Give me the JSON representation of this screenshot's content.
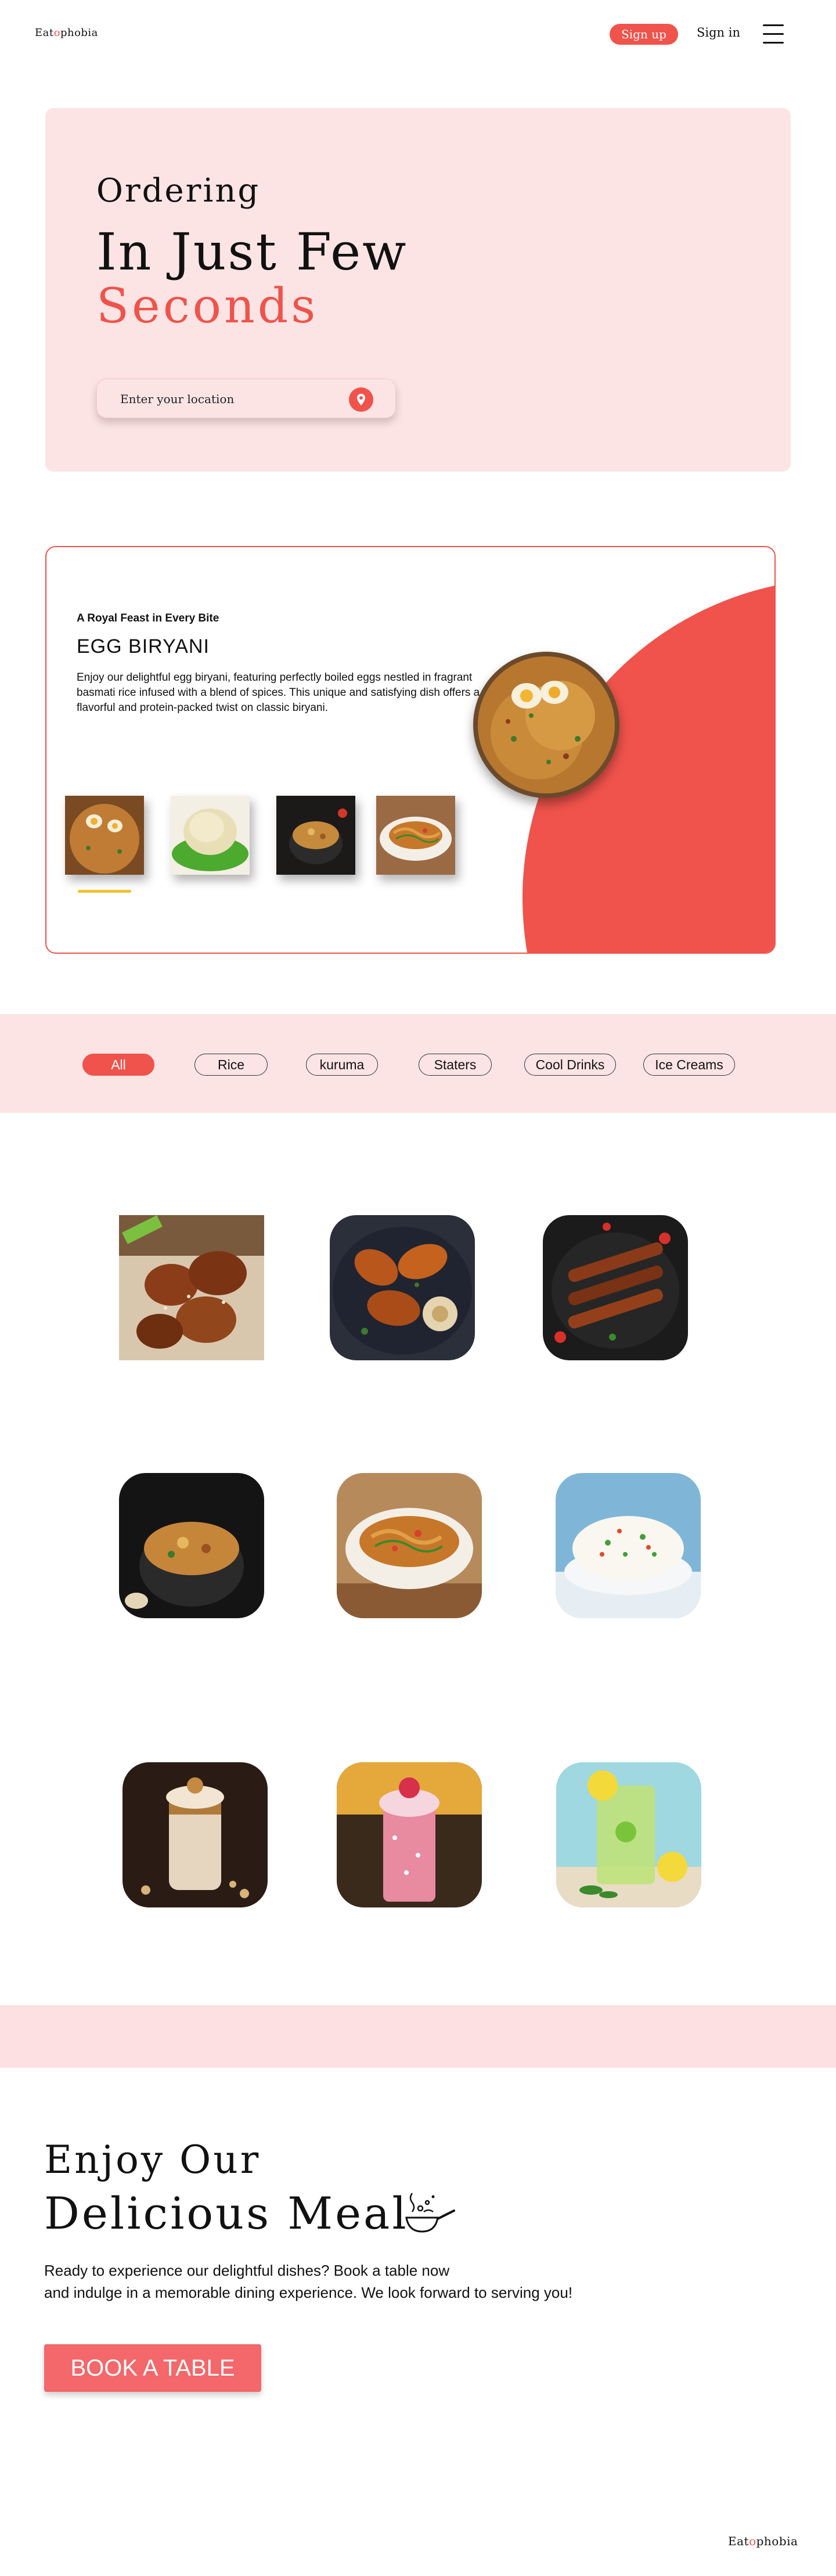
{
  "header": {
    "logo_prefix": "Eat",
    "logo_o": "o",
    "logo_suffix": "phobia",
    "signup_label": "Sign up",
    "signin_label": "Sign in",
    "menu_icon": "hamburger-icon"
  },
  "hero": {
    "line1": "Ordering",
    "line2": "In Just Few",
    "line3": "Seconds",
    "location_placeholder": "Enter your location",
    "location_icon": "map-pin-icon"
  },
  "featured": {
    "tagline": "A Royal Feast in Every Bite",
    "title": "EGG BIRYANI",
    "description": "Enjoy our delightful egg biryani, featuring perfectly boiled eggs nestled in fragrant basmati rice infused with a blend of spices. This unique and satisfying dish offers a flavorful and protein-packed twist on classic biryani."
  },
  "categories": [
    {
      "label": "All",
      "active": true
    },
    {
      "label": "Rice",
      "active": false
    },
    {
      "label": "kuruma",
      "active": false
    },
    {
      "label": "Staters",
      "active": false
    },
    {
      "label": "Cool Drinks",
      "active": false
    },
    {
      "label": "Ice Creams",
      "active": false
    }
  ],
  "cta": {
    "line1": "Enjoy Our",
    "line2": "Delicious Meal",
    "para1": "Ready to experience our delightful dishes? Book a table now",
    "para2": "and indulge in a memorable dining experience. We look forward to serving you!",
    "button_label": "BOOK A TABLE",
    "icon": "cooking-pan-icon"
  },
  "footer": {
    "logo_prefix": "Eat",
    "logo_o": "o",
    "logo_suffix": "phobia"
  },
  "colors": {
    "accent": "#f0534b",
    "pink_bg": "#fde4e4",
    "button": "#f4676a",
    "indicator": "#f2c02e"
  }
}
